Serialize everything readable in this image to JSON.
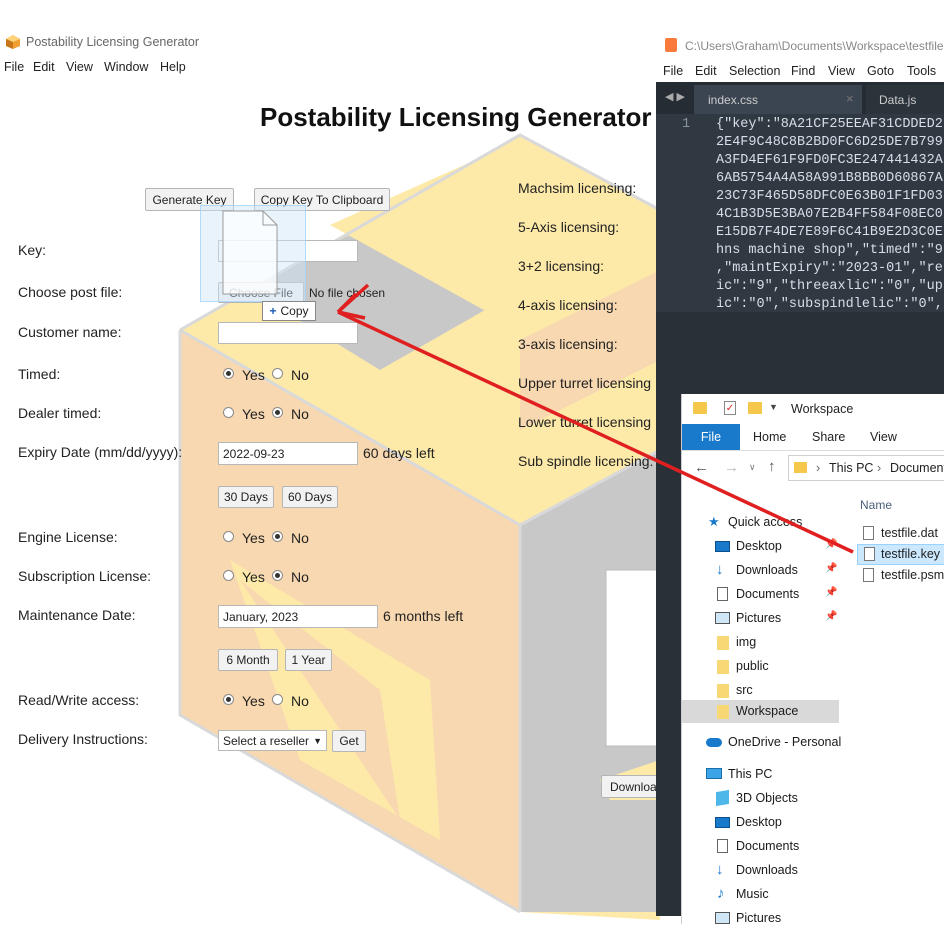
{
  "app": {
    "title": "Postability Licensing Generator",
    "menu": [
      "File",
      "Edit",
      "View",
      "Window",
      "Help"
    ],
    "heading": "Postability Licensing Generator"
  },
  "buttons": {
    "generate_key": "Generate Key",
    "copy_key": "Copy Key To Clipboard",
    "choose_file": "Choose File",
    "no_file": "No file chosen",
    "days30": "30 Days",
    "days60": "60 Days",
    "month6": "6 Month",
    "year1": "1 Year",
    "get": "Get",
    "download": "Downloa"
  },
  "drag": {
    "copy_label": "Copy",
    "copy_symbol": "+"
  },
  "form": {
    "key_label": "Key:",
    "post_file_label": "Choose post file:",
    "customer_label": "Customer name:",
    "timed_label": "Timed:",
    "dealer_timed_label": "Dealer timed:",
    "expiry_label": "Expiry Date (mm/dd/yyyy):",
    "expiry_value": "2022-09-23",
    "expiry_left": "60 days left",
    "engine_label": "Engine License:",
    "subscription_label": "Subscription License:",
    "maintenance_label": "Maintenance Date:",
    "maintenance_value": "January, 2023",
    "maintenance_left": "6 months left",
    "rw_label": "Read/Write access:",
    "delivery_label": "Delivery Instructions:",
    "reseller_select": "Select a reseller",
    "yes": "Yes",
    "no": "No"
  },
  "licensing": [
    "Machsim licensing:",
    "5-Axis licensing:",
    "3+2 licensing:",
    "4-axis licensing:",
    "3-axis licensing:",
    "Upper turret licensing",
    "Lower turret licensing",
    "Sub spindle licensing:"
  ],
  "editor": {
    "title": "C:\\Users\\Graham\\Documents\\Workspace\\testfile",
    "menu": [
      "File",
      "Edit",
      "Selection",
      "Find",
      "View",
      "Goto",
      "Tools"
    ],
    "tabs": [
      "index.css",
      "Data.js"
    ],
    "line_number": "1",
    "lines": [
      "{\"key\":\"8A21CF25EEAF31CDDED2",
      "2E4F9C48C8B2BD0FC6D25DE7B799",
      "A3FD4EF61F9FD0FC3E247441432A",
      "6AB5754A4A58A991B8BB0D60867A",
      "23C73F465D58DFC0E63B01F1FD03",
      "4C1B3D5E3BA07E2B4FF584F08EC0",
      "E15DB7F4DE7E89F6C41B9E2D3C0E",
      "hns machine shop\",\"timed\":\"9",
      ",\"maintExpiry\":\"2023-01\",\"re",
      "ic\":\"9\",\"threeaxlic\":\"0\",\"up",
      "ic\":\"0\",\"subspindlelic\":\"0\","
    ]
  },
  "explorer": {
    "breadcrumb_title": "Workspace",
    "ribbon_tabs": [
      "File",
      "Home",
      "Share",
      "View"
    ],
    "path": [
      "This PC",
      "Document"
    ],
    "column_name": "Name",
    "files": [
      "testfile.dat",
      "testfile.key",
      "testfile.psm"
    ],
    "nav": [
      {
        "label": "Quick access",
        "icon": "star-icon"
      },
      {
        "label": "Desktop",
        "icon": "desktop-icon",
        "pinned": true
      },
      {
        "label": "Downloads",
        "icon": "download-icon",
        "pinned": true
      },
      {
        "label": "Documents",
        "icon": "documents-icon",
        "pinned": true
      },
      {
        "label": "Pictures",
        "icon": "pictures-icon",
        "pinned": true
      },
      {
        "label": "img",
        "icon": "folder-icon"
      },
      {
        "label": "public",
        "icon": "folder-icon"
      },
      {
        "label": "src",
        "icon": "folder-icon"
      },
      {
        "label": "Workspace",
        "icon": "folder-icon",
        "selected": true
      },
      {
        "label": "OneDrive - Personal",
        "icon": "cloud-icon"
      },
      {
        "label": "This PC",
        "icon": "pc-icon"
      },
      {
        "label": "3D Objects",
        "icon": "cube-icon"
      },
      {
        "label": "Desktop",
        "icon": "desktop-icon"
      },
      {
        "label": "Documents",
        "icon": "documents-icon"
      },
      {
        "label": "Downloads",
        "icon": "download-icon"
      },
      {
        "label": "Music",
        "icon": "music-icon"
      },
      {
        "label": "Pictures",
        "icon": "pictures-icon"
      }
    ]
  },
  "colors": {
    "editor_bg": "#303841",
    "explorer_accent": "#1979ca",
    "arrow": "#e02020",
    "logo_peach": "#f8d8b0",
    "logo_yellow": "#fde9a8",
    "logo_gray": "#c8c8c8"
  }
}
